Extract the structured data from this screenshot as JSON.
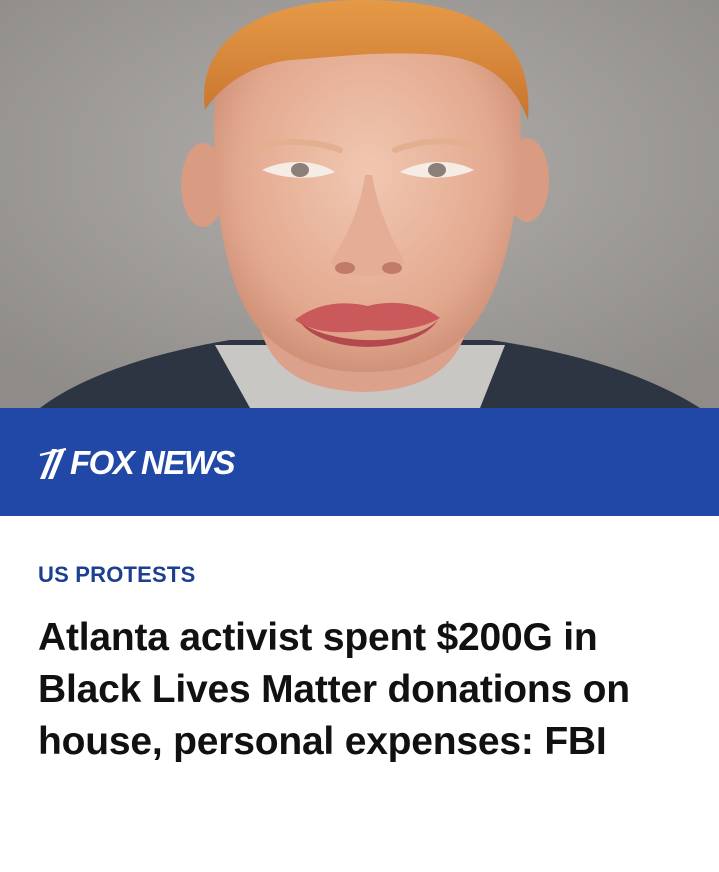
{
  "photo": {
    "icon": "mugshot-photo",
    "background_color": "#a09d9a"
  },
  "banner": {
    "brand": "FOX NEWS",
    "background_color": "#2148a6",
    "logo_icon": "fox-news-logo-icon"
  },
  "article": {
    "category": "US PROTESTS",
    "category_color": "#1d3f8f",
    "headline": "Atlanta activist spent $200G in Black Lives Matter donations on house, personal expenses: FBI"
  }
}
